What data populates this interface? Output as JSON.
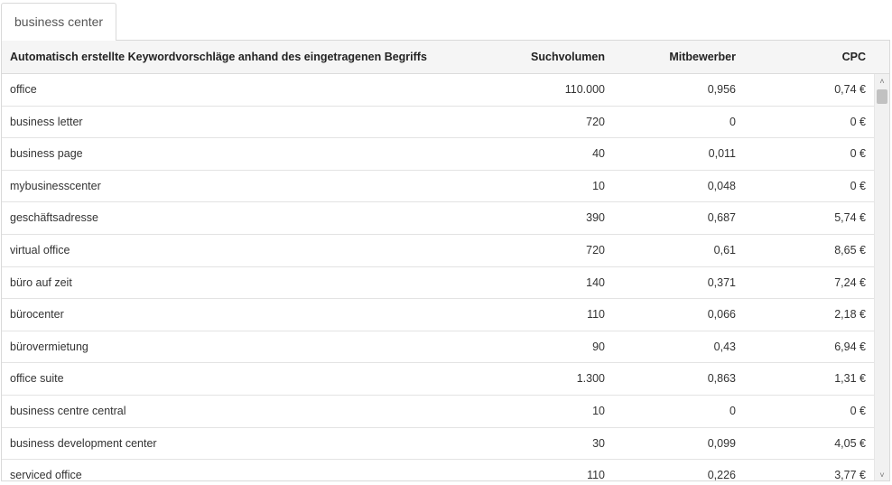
{
  "tab": {
    "label": "business center"
  },
  "table": {
    "headers": {
      "keyword": "Automatisch erstellte Keywordvorschläge anhand des eingetragenen Begriffs",
      "volume": "Suchvolumen",
      "competitors": "Mitbewerber",
      "cpc": "CPC"
    },
    "rows": [
      {
        "keyword": "office",
        "volume": "110.000",
        "competitors": "0,956",
        "cpc": "0,74 €"
      },
      {
        "keyword": "business letter",
        "volume": "720",
        "competitors": "0",
        "cpc": "0 €"
      },
      {
        "keyword": "business page",
        "volume": "40",
        "competitors": "0,011",
        "cpc": "0 €"
      },
      {
        "keyword": "mybusinesscenter",
        "volume": "10",
        "competitors": "0,048",
        "cpc": "0 €"
      },
      {
        "keyword": "geschäftsadresse",
        "volume": "390",
        "competitors": "0,687",
        "cpc": "5,74 €"
      },
      {
        "keyword": "virtual office",
        "volume": "720",
        "competitors": "0,61",
        "cpc": "8,65 €"
      },
      {
        "keyword": "büro auf zeit",
        "volume": "140",
        "competitors": "0,371",
        "cpc": "7,24 €"
      },
      {
        "keyword": "bürocenter",
        "volume": "110",
        "competitors": "0,066",
        "cpc": "2,18 €"
      },
      {
        "keyword": "bürovermietung",
        "volume": "90",
        "competitors": "0,43",
        "cpc": "6,94 €"
      },
      {
        "keyword": "office suite",
        "volume": "1.300",
        "competitors": "0,863",
        "cpc": "1,31 €"
      },
      {
        "keyword": "business centre central",
        "volume": "10",
        "competitors": "0",
        "cpc": "0 €"
      },
      {
        "keyword": "business development center",
        "volume": "30",
        "competitors": "0,099",
        "cpc": "4,05 €"
      },
      {
        "keyword": "serviced office",
        "volume": "110",
        "competitors": "0,226",
        "cpc": "3,77 €"
      }
    ]
  },
  "scrollbar": {
    "up_glyph": "˄",
    "down_glyph": "˅"
  }
}
